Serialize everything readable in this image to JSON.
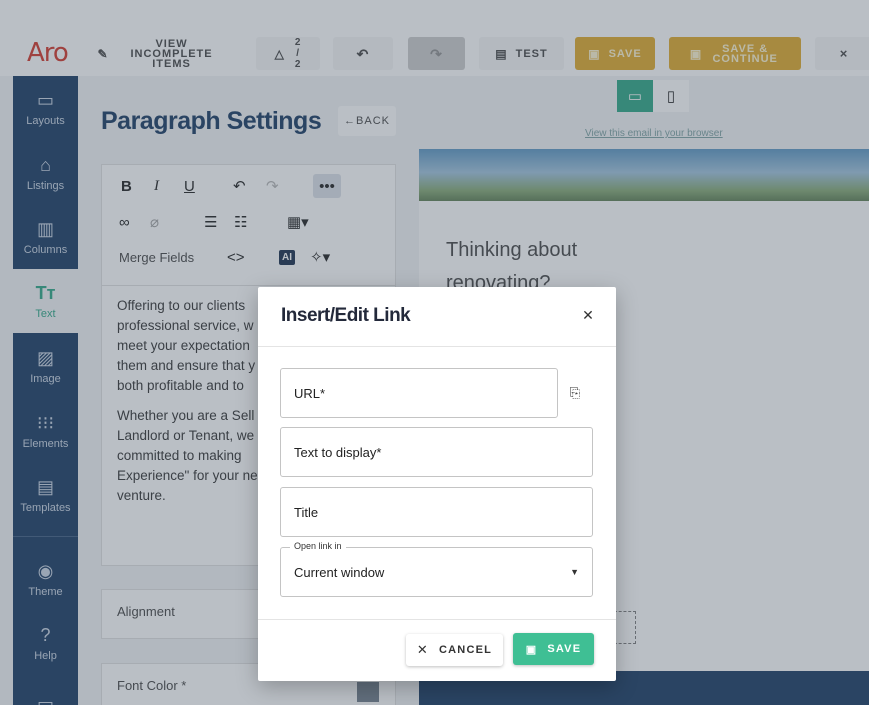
{
  "app": {
    "logo": "Aro"
  },
  "topbar": {
    "incomplete_label": "View Incomplete Items",
    "nav_current": "2",
    "nav_sep": "/",
    "nav_total": "2",
    "test_label": "Test",
    "save_label": "Save",
    "save_continue_label": "Save & Continue",
    "close_glyph": "×"
  },
  "sidebar": {
    "items": [
      {
        "label": "Layouts",
        "icon": "layouts-icon"
      },
      {
        "label": "Listings",
        "icon": "home-icon"
      },
      {
        "label": "Columns",
        "icon": "columns-icon"
      },
      {
        "label": "Text",
        "icon": "text-icon"
      },
      {
        "label": "Image",
        "icon": "image-icon"
      },
      {
        "label": "Elements",
        "icon": "grid-icon"
      },
      {
        "label": "Templates",
        "icon": "document-icon"
      },
      {
        "label": "Theme",
        "icon": "palette-icon"
      },
      {
        "label": "Help",
        "icon": "help-icon"
      },
      {
        "label": "",
        "icon": "chat-icon"
      }
    ]
  },
  "settings": {
    "title": "Paragraph Settings",
    "back_label": "←BACK",
    "merge_fields_label": "Merge Fields",
    "ai_badge": "AI",
    "paragraphs": [
      [
        "Offering to our clients",
        "professional service, w",
        "meet your expectation",
        "them and ensure that y",
        "both profitable and to"
      ],
      [
        "Whether you are a Sell",
        "Landlord or Tenant, we",
        "committed to making",
        "Experience\" for your ne",
        "venture."
      ]
    ],
    "alignment_label": "Alignment",
    "font_color_label": "Font Color *",
    "font_color_value": "#7d8894"
  },
  "preview": {
    "view_in_browser": "View this email in your browser",
    "heading_line1": "Thinking about",
    "heading_line2": "renovating?"
  },
  "modal": {
    "title": "Insert/Edit Link",
    "url_placeholder": "URL*",
    "text_placeholder": "Text to display*",
    "title_placeholder": "Title",
    "open_in_label": "Open link in",
    "open_in_value": "Current window",
    "cancel_label": "CANCEL",
    "save_label": "SAVE"
  },
  "colors": {
    "brand_navy": "#2b4a6f",
    "accent_green": "#3fbf94",
    "save_yellow": "#e3b23c",
    "logo_red": "#d8463a"
  }
}
